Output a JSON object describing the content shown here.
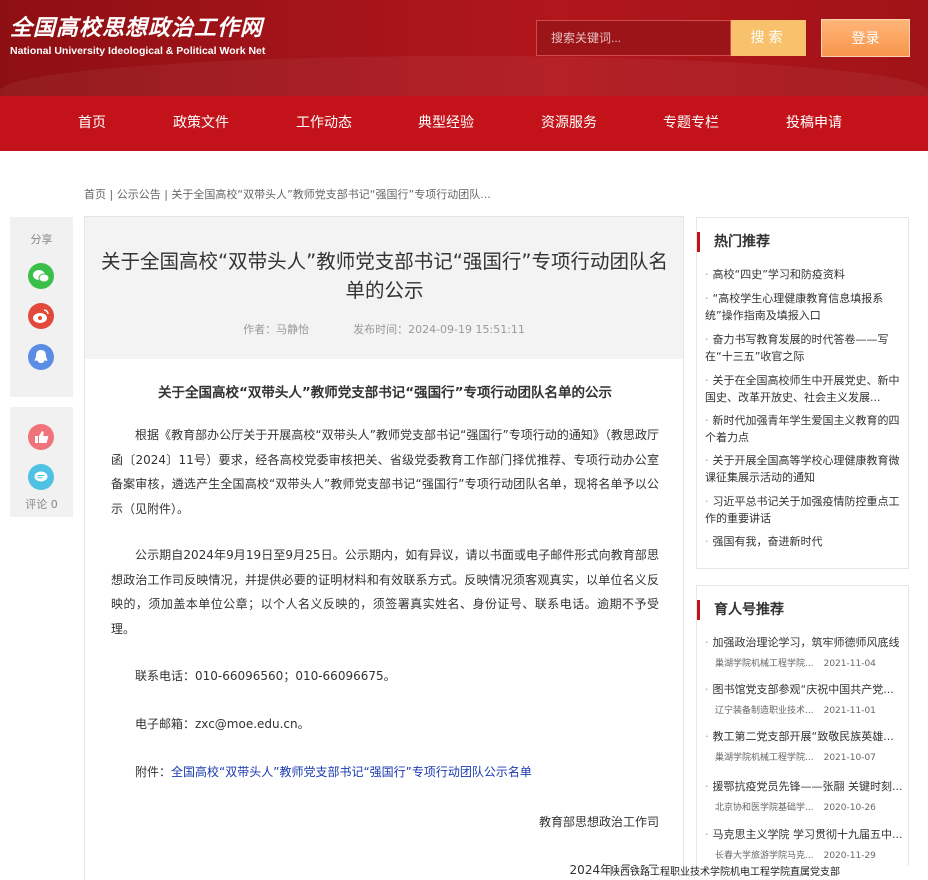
{
  "header": {
    "logo_cn": "全国高校思想政治工作网",
    "logo_en": "National University Ideological & Political Work Net",
    "search_placeholder": "搜索关键词...",
    "search_button": "搜索",
    "login_button": "登录"
  },
  "nav": [
    "首页",
    "政策文件",
    "工作动态",
    "典型经验",
    "资源服务",
    "专题专栏",
    "投稿申请"
  ],
  "breadcrumb": {
    "home": "首页",
    "sep1": " | ",
    "section": "公示公告",
    "sep2": " | ",
    "current": "关于全国高校“双带头人”教师党支部书记“强国行”专项行动团队..."
  },
  "share": {
    "title": "分享",
    "icons": [
      "wechat-icon",
      "weibo-icon",
      "qq-icon"
    ],
    "comment_label": "评论 0"
  },
  "article": {
    "title": "关于全国高校“双带头人”教师党支部书记“强国行”专项行动团队名单的公示",
    "author": "作者：马静怡",
    "time": "发布时间：2024-09-19 15:51:11",
    "subtitle": "关于全国高校“双带头人”教师党支部书记“强国行”专项行动团队名单的公示",
    "para1": "根据《教育部办公厅关于开展高校“双带头人”教师党支部书记“强国行”专项行动的通知》（教思政厅函〔2024〕11号）要求，经各高校党委审核把关、省级党委教育工作部门择优推荐、专项行动办公室备案审核，遴选产生全国高校“双带头人”教师党支部书记“强国行”专项行动团队名单，现将名单予以公示（见附件）。",
    "para2": "公示期自2024年9月19日至9月25日。公示期内，如有异议，请以书面或电子邮件形式向教育部思想政治工作司反映情况，并提供必要的证明材料和有效联系方式。反映情况须客观真实，以单位名义反映的，须加盖本单位公章；以个人名义反映的，须签署真实姓名、身份证号、联系电话。逾期不予受理。",
    "phone": "联系电话：010-66096560；010-66096675。",
    "email": "电子邮箱：zxc@moe.edu.cn。",
    "attach_label": "附件：",
    "attach_link": "全国高校“双带头人”教师党支部书记“强国行”专项行动团队公示名单",
    "sign_org": "教育部思想政治工作司",
    "sign_date": "2024年9月19日"
  },
  "hot": {
    "title": "热门推荐",
    "items": [
      "高校“四史”学习和防疫资料",
      "“高校学生心理健康教育信息填报系统”操作指南及填报入口",
      "奋力书写教育发展的时代答卷——写在“十三五”收官之际",
      "关于在全国高校师生中开展党史、新中国史、改革开放史、社会主义发展...",
      "新时代加强青年学生爱国主义教育的四个着力点",
      "关于开展全国高等学校心理健康教育微课征集展示活动的通知",
      "习近平总书记关于加强疫情防控重点工作的重要讲话",
      "强国有我，奋进新时代"
    ]
  },
  "rec": {
    "title": "育人号推荐",
    "items": [
      {
        "title": "加强政治理论学习，筑牢师德师风底线",
        "source": "巢湖学院机械工程学院...",
        "date": "2021-11-04"
      },
      {
        "title": "图书馆党支部参观“庆祝中国共产党...",
        "source": "辽宁装备制造职业技术...",
        "date": "2021-11-01"
      },
      {
        "title": "教工第二党支部开展“致敬民族英雄...",
        "source": "巢湖学院机械工程学院...",
        "date": "2021-10-07"
      },
      {
        "title": "援鄂抗疫党员先锋——张翮 关键时刻...",
        "source": "北京协和医学院基础学...",
        "date": "2020-10-26"
      },
      {
        "title": "马克思主义学院 学习贯彻十九届五中...",
        "source": "长春大学旅游学院马克...",
        "date": "2020-11-29"
      }
    ]
  },
  "footer_strip": "陕西铁路工程职业技术学院机电工程学院直属党支部"
}
